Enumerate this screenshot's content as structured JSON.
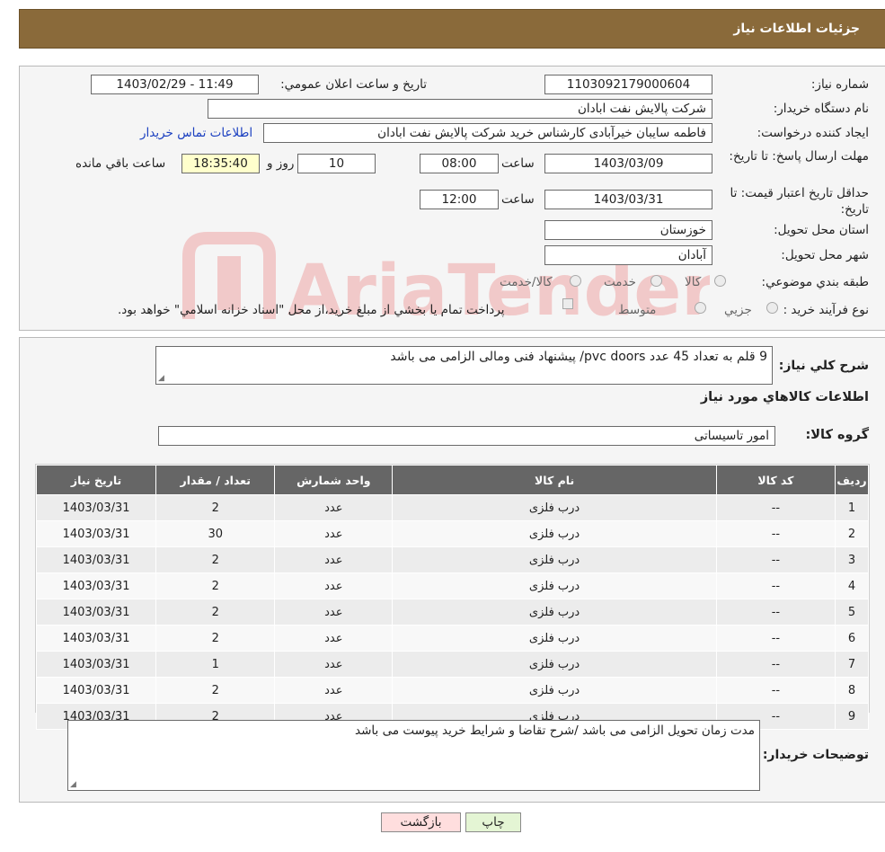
{
  "header": {
    "title": "جزئيات اطلاعات نياز"
  },
  "details": {
    "need_number_label": "شماره نياز:",
    "need_number": "1103092179000604",
    "announce_label": "تاريخ و ساعت اعلان عمومي:",
    "announce_value": "1403/02/29 - 11:49",
    "buyer_org_label": "نام دستگاه خريدار:",
    "buyer_org": "شرکت پالايش نفت ابادان",
    "creator_label": "ايجاد کننده درخواست:",
    "creator": "فاطمه سایبان خیرآبادی کارشناس خرید شرکت پالایش نفت ابادان",
    "contact_link": "اطلاعات تماس خريدار",
    "deadline_label": "مهلت ارسال پاسخ: تا تاريخ:",
    "deadline_date": "1403/03/09",
    "time_label": "ساعت",
    "deadline_time": "08:00",
    "days_value": "10",
    "days_label": "روز و",
    "remaining_value": "18:35:40",
    "remaining_label": "ساعت باقي مانده",
    "validity_label": "حداقل تاريخ اعتبار قيمت: تا تاريخ:",
    "validity_date": "1403/03/31",
    "validity_time": "12:00",
    "province_label": "استان محل تحويل:",
    "province": "خوزستان",
    "city_label": "شهر محل تحويل:",
    "city": "آبادان",
    "category_label": "طبقه بندي موضوعي:",
    "category_options": [
      "کالا",
      "خدمت",
      "کالا/خدمت"
    ],
    "process_label": "نوع فرآيند خريد :",
    "process_options": [
      "جزيي",
      "متوسط"
    ],
    "process_note": "پرداخت تمام يا بخشي از مبلغ خريد،از محل \"اسناد خزانه اسلامي\" خواهد بود."
  },
  "description": {
    "label": "شرح کلي نياز:",
    "value": "9 قلم به تعداد 45 عدد pvc doors/ پیشنهاد فنی ومالی الزامی می باشد"
  },
  "goods": {
    "section_title": "اطلاعات کالاهاي مورد نياز",
    "group_label": "گروه کالا:",
    "group_value": "امور تاسیساتی"
  },
  "table": {
    "headers": [
      "رديف",
      "کد کالا",
      "نام کالا",
      "واحد شمارش",
      "تعداد / مقدار",
      "تاريخ نياز"
    ],
    "rows": [
      [
        "1",
        "--",
        "درب فلزی",
        "عدد",
        "2",
        "1403/03/31"
      ],
      [
        "2",
        "--",
        "درب فلزی",
        "عدد",
        "30",
        "1403/03/31"
      ],
      [
        "3",
        "--",
        "درب فلزی",
        "عدد",
        "2",
        "1403/03/31"
      ],
      [
        "4",
        "--",
        "درب فلزی",
        "عدد",
        "2",
        "1403/03/31"
      ],
      [
        "5",
        "--",
        "درب فلزی",
        "عدد",
        "2",
        "1403/03/31"
      ],
      [
        "6",
        "--",
        "درب فلزی",
        "عدد",
        "2",
        "1403/03/31"
      ],
      [
        "7",
        "--",
        "درب فلزی",
        "عدد",
        "1",
        "1403/03/31"
      ],
      [
        "8",
        "--",
        "درب فلزی",
        "عدد",
        "2",
        "1403/03/31"
      ],
      [
        "9",
        "--",
        "درب فلزی",
        "عدد",
        "2",
        "1403/03/31"
      ]
    ]
  },
  "buyer_notes": {
    "label": "توضيحات خريدار:",
    "value": "مدت زمان تحویل الزامی می باشد /شرح تقاضا و شرایط خرید پیوست می باشد"
  },
  "buttons": {
    "print": "چاپ",
    "back": "بازگشت"
  },
  "watermark": {
    "text": "AriaTender.neT"
  },
  "colors": {
    "header_bg": "#8a6a3a",
    "table_header_bg": "#666666",
    "remaining_bg": "#ffffcc",
    "back_button_bg": "#ffdede",
    "print_button_bg": "#e4f5d4",
    "link": "#1a3fc0"
  }
}
